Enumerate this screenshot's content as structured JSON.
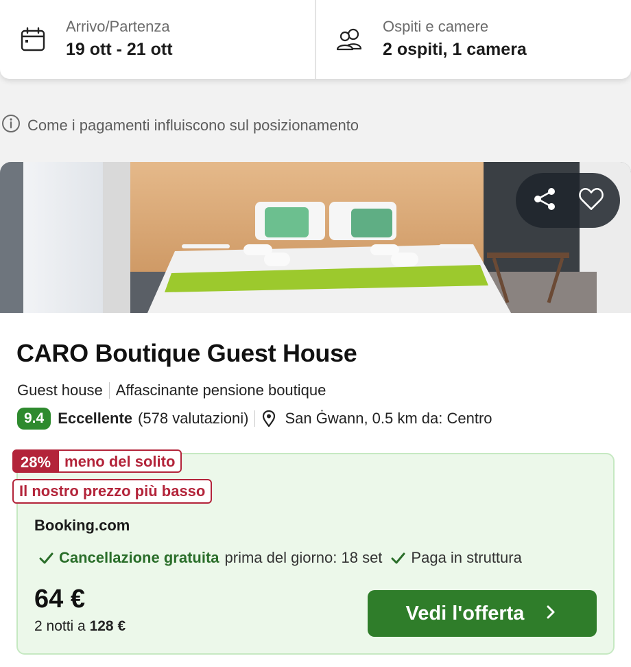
{
  "search": {
    "dates_label": "Arrivo/Partenza",
    "dates_value": "19 ott - 21 ott",
    "guests_label": "Ospiti e camere",
    "guests_value": "2 ospiti, 1 camera"
  },
  "info": {
    "text": "Come i pagamenti influiscono sul posizionamento"
  },
  "hotel": {
    "name": "CARO Boutique Guest House",
    "type": "Guest house",
    "description": "Affascinante pensione boutique",
    "score": "9.4",
    "rating_word": "Eccellente",
    "reviews": "(578 valutazioni)",
    "location": "San Ġwann, 0.5 km da: Centro"
  },
  "deal": {
    "discount_pct": "28%",
    "discount_text": "meno del solito",
    "lowest_price": "Il nostro prezzo più basso",
    "provider": "Booking.com",
    "perk_cancel_strong": "Cancellazione gratuita",
    "perk_cancel_rest": "prima del giorno: 18 set",
    "perk_pay": "Paga in struttura",
    "price": "64 €",
    "nights_prefix": "2 notti a",
    "nights_total": "128 €",
    "cta_label": "Vedi l'offerta"
  },
  "colors": {
    "accent_green": "#2f7d2a",
    "score_green": "#2e8a2e",
    "badge_red": "#b3243a",
    "deal_bg": "#ecf8ea"
  },
  "icons": {
    "dates": "calendar-icon",
    "guests": "users-icon",
    "info": "info-icon",
    "share": "share-icon",
    "favorite": "heart-icon",
    "location": "map-pin-icon",
    "check": "check-icon",
    "cta": "chevron-right-icon"
  }
}
